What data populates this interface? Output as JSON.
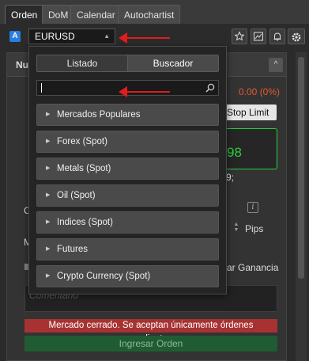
{
  "tabs": [
    {
      "label": "Orden",
      "active": true
    },
    {
      "label": "DoM",
      "active": false
    },
    {
      "label": "Calendar",
      "active": false
    },
    {
      "label": "Autochartist",
      "active": false
    }
  ],
  "symbol": {
    "badge": "A",
    "value": "EURUSD",
    "caret": "▲"
  },
  "toolbar": {
    "icons": [
      "star-icon",
      "chart-icon",
      "bell-icon",
      "gear-icon"
    ]
  },
  "panel": {
    "header_fragment": "Nu",
    "collapse_glyph": "^",
    "change": "0.00 (0%)",
    "stop_limit": "Stop Limit",
    "price_fragment": "98",
    "fragment_9": "9;",
    "fragment_c": "C",
    "fragment_m": "M",
    "info_glyph": "i",
    "pips": "Pips",
    "take_profit": "ar Ganancia",
    "comment_placeholder": "Comentario",
    "closed_banner": "Mercado cerrado. Se aceptan únicamente órdenes pendientes.",
    "submit": "Ingresar Orden"
  },
  "dropdown": {
    "segments": [
      "Listado",
      "Buscador"
    ],
    "active_segment": "Buscador",
    "search_value": "",
    "categories": [
      "Mercados Populares",
      "Forex (Spot)",
      "Metals (Spot)",
      "Oil (Spot)",
      "Indices (Spot)",
      "Futures",
      "Crypto Currency (Spot)"
    ]
  },
  "colors": {
    "accent_blue": "#2a7de1",
    "annotation_red": "#e21c1c",
    "price_green": "#2ecc40",
    "change_orange": "#e05a2e",
    "banner_red": "#a83232",
    "submit_green": "#1f5c33"
  }
}
